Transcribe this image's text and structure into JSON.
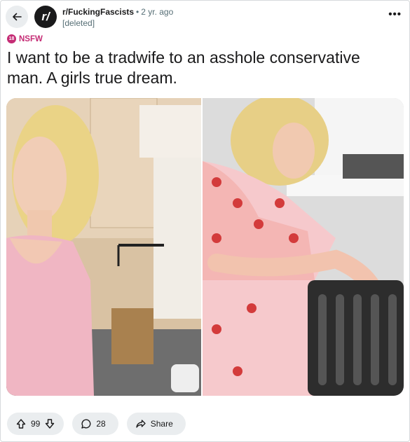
{
  "header": {
    "subreddit": "r/FuckingFascists",
    "separator": "•",
    "time": "2 yr. ago",
    "author": "[deleted]",
    "subreddit_icon_text": "r/",
    "more_label": "•••"
  },
  "post": {
    "nsfw_badge_text": "18",
    "nsfw_label": "NSFW",
    "title": "I want to be a tradwife to an asshole conservative man. A girls true dream."
  },
  "actions": {
    "vote_count": "99",
    "comment_count": "28",
    "share_label": "Share"
  },
  "colors": {
    "nsfw": "#c52c75",
    "pill_bg": "#eaedef",
    "text": "#1a1a1b",
    "meta": "#576f76"
  }
}
